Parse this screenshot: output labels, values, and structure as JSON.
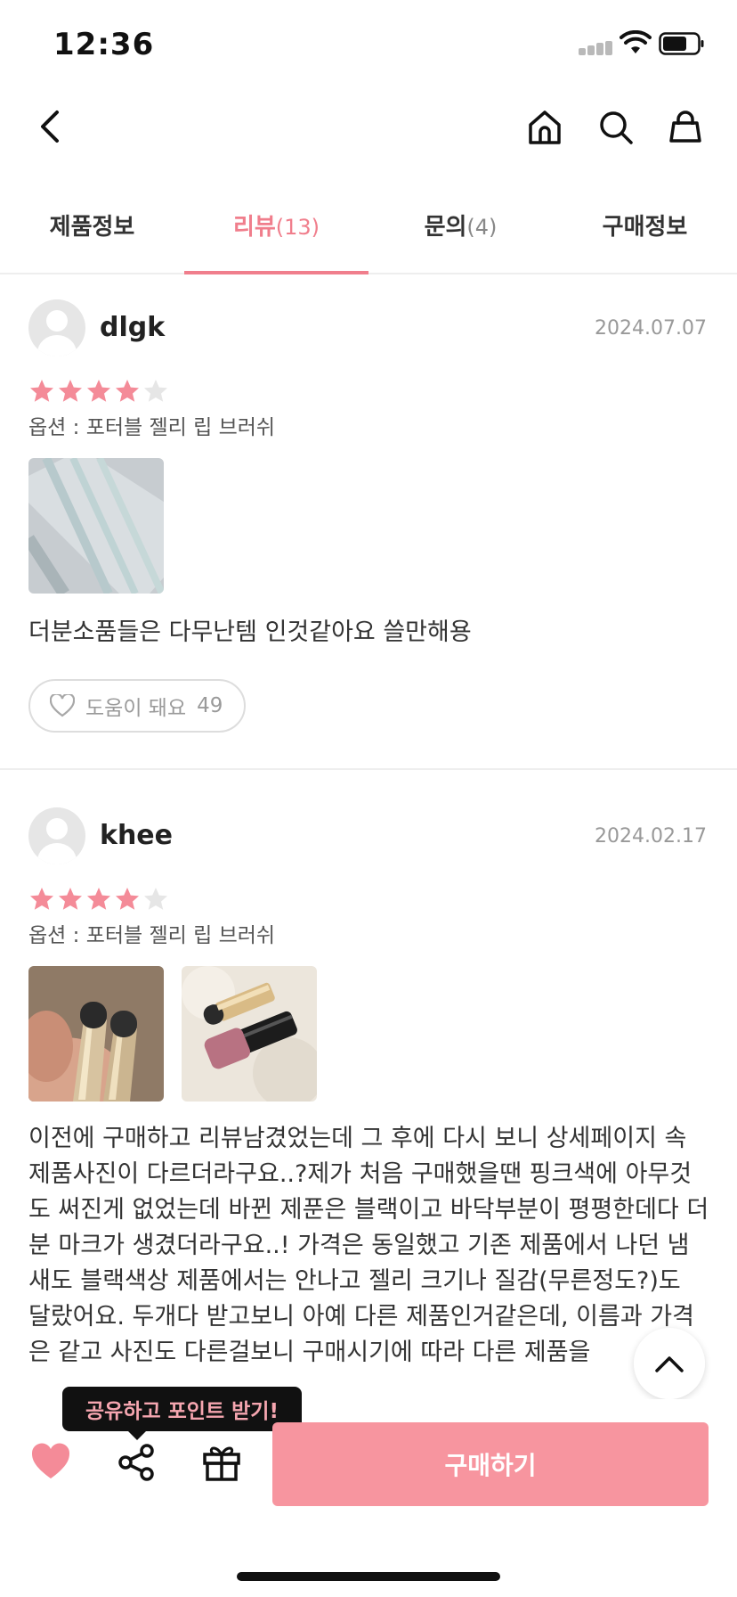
{
  "status_bar": {
    "time": "12:36"
  },
  "tabs": [
    {
      "label": "제품정보",
      "count": ""
    },
    {
      "label": "리뷰",
      "count": "(13)"
    },
    {
      "label": "문의",
      "count": "(4)"
    },
    {
      "label": "구매정보",
      "count": ""
    }
  ],
  "reviews": [
    {
      "username": "dlgk",
      "date": "2024.07.07",
      "rating": 4,
      "max_rating": 5,
      "option": "옵션 : 포터블 젤리 립 브러쉬",
      "text": "더분소품들은 다무난템 인것같아요 쓸만해용",
      "helpful_label": "도움이 돼요",
      "helpful_count": "49"
    },
    {
      "username": "khee",
      "date": "2024.02.17",
      "rating": 4,
      "max_rating": 5,
      "option": "옵션 : 포터블 젤리 립 브러쉬",
      "text": "이전에 구매하고 리뷰남겼었는데 그 후에 다시 보니 상세페이지 속 제품사진이 다르더라구요..?제가 처음 구매했을땐 핑크색에 아무것도 써진게 없었는데 바뀐 제푼은 블랙이고 바닥부분이 평평한데다 더분 마크가 생겼더라구요..! 가격은 동일했고 기존 제품에서 나던 냄새도 블랙색상 제품에서는 안나고 젤리 크기나 질감(무른정도?)도 달랐어요. 두개다 받고보니 아예 다른 제품인거같은데, 이름과 가격은 같고 사진도 다른걸보니 구매시기에 따라 다른 제품을"
    }
  ],
  "tooltip": "공유하고 포인트 받기!",
  "buy_button": "구매하기",
  "colors": {
    "accent": "#f07e8c",
    "buy": "#f7959f",
    "star": "#f48b98",
    "star_empty": "#e6e6e6"
  }
}
